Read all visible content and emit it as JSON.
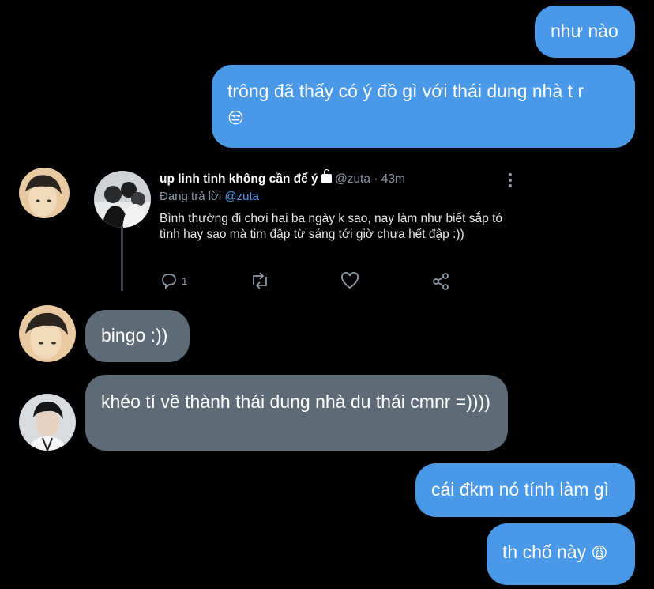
{
  "messages": [
    {
      "side": "out",
      "text": "như nào"
    },
    {
      "side": "out",
      "text": "trông đã thấy có ý đồ gì với thái dung nhà t r",
      "emoji": "😒"
    },
    {
      "side": "in",
      "text": "bingo :))"
    },
    {
      "side": "in",
      "text": "khéo tí về thành thái dung nhà du thái cmnr =))))"
    },
    {
      "side": "out",
      "text": "cái đkm nó tính làm gì"
    },
    {
      "side": "out",
      "text": "th chố này",
      "emoji": "😩"
    }
  ],
  "tweet": {
    "name": "up linh tinh không cần để ý",
    "handle": "@zuta",
    "time": "· 43m",
    "reply_prefix": "Đang trả lời",
    "reply_handle": "@zuta",
    "body": "Bình thường đi chơi hai ba ngày k sao, nay làm như biết sắp tỏ tình hay sao mà tim đập từ sáng tới giờ chưa hết đập :))",
    "reply_count": "1"
  },
  "icons": [
    "more-icon",
    "lock-icon",
    "reply-icon",
    "retweet-icon",
    "like-icon",
    "share-icon"
  ],
  "colors": {
    "outgoing": "#4a99e9",
    "incoming": "#5e6b76",
    "background": "#000000"
  }
}
